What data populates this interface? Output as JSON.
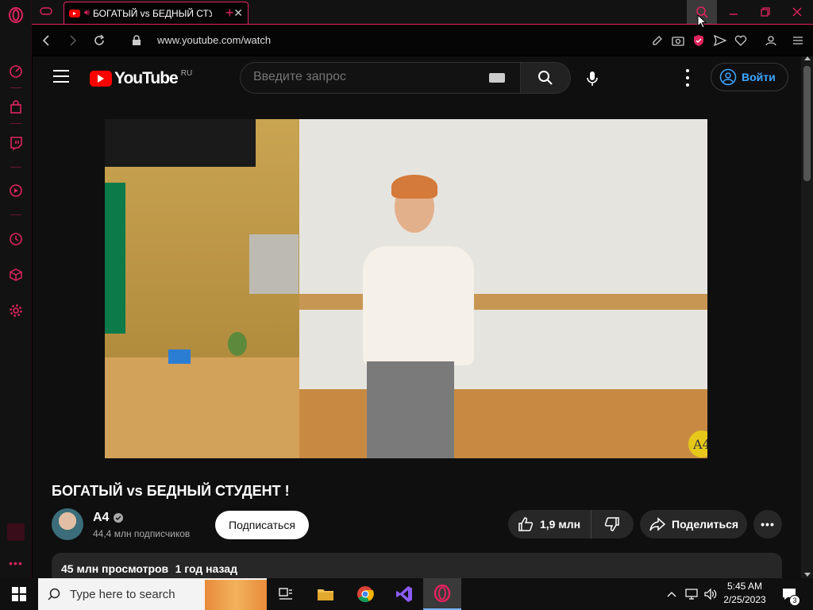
{
  "browser": {
    "tab": {
      "title": "БОГАТЫЙ vs БЕДНЫЙ СТУДЕНТ !"
    },
    "url": "www.youtube.com/watch",
    "new_tab": "+"
  },
  "youtube": {
    "logo_text": "YouTube",
    "region": "RU",
    "search": {
      "placeholder": "Введите запрос"
    },
    "signin": "Войти",
    "video": {
      "title": "БОГАТЫЙ vs БЕДНЫЙ СТУДЕНТ !",
      "watermark": "A4"
    },
    "channel": {
      "name": "A4",
      "subscribers": "44,4 млн подписчиков"
    },
    "subscribe": "Подписаться",
    "likes": "1,9 млн",
    "share": "Поделиться",
    "description": {
      "views": "45 млн просмотров",
      "date": "1 год назад"
    }
  },
  "taskbar": {
    "search_placeholder": "Type here to search",
    "time": "5:45 AM",
    "date": "2/25/2023",
    "notifications": "3"
  },
  "colors": {
    "accent": "#e0245e",
    "yt_red": "#ff0000",
    "signin_blue": "#3ea6ff"
  }
}
